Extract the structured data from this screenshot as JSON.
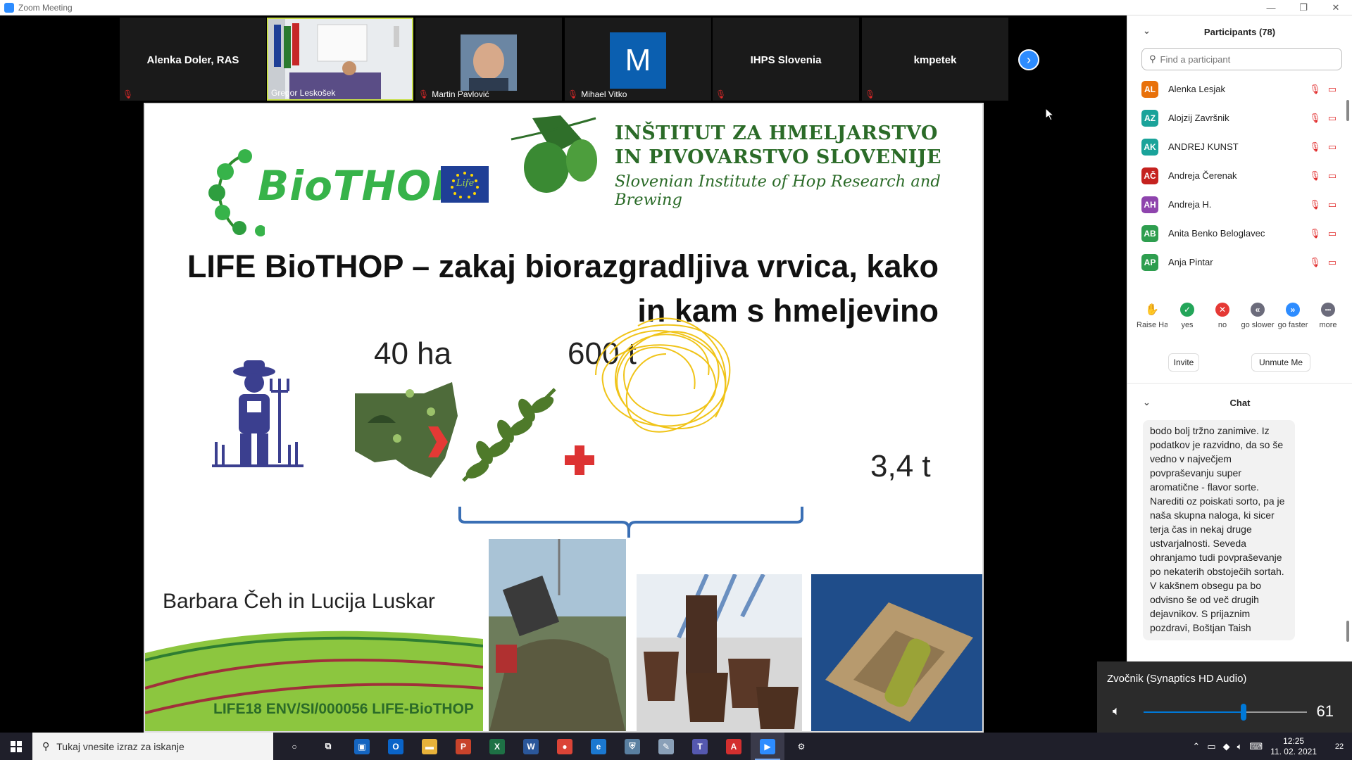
{
  "window": {
    "title": "Zoom Meeting",
    "controls": [
      "—",
      "❐",
      "✕"
    ]
  },
  "video_strip": {
    "tiles": [
      {
        "name": "Alenka Doler, RAS",
        "label": ""
      },
      {
        "name": "",
        "label": "Gregor Leskošek"
      },
      {
        "name": "",
        "label": "Martin Pavlović"
      },
      {
        "name": "",
        "label": "Mihael Vitko",
        "initial": "M"
      },
      {
        "name": "IHPS Slovenia",
        "label": ""
      },
      {
        "name": "kmpetek",
        "label": ""
      }
    ],
    "next_icon": "chevron-right-icon"
  },
  "slide": {
    "logo_text": "BioTHOP",
    "eu_label": "Life",
    "institute_line1": "INŠTITUT ZA HMELJARSTVO",
    "institute_line2": "IN PIVOVARSTVO SLOVENIJE",
    "institute_line3": "Slovenian Institute of Hop Research and Brewing",
    "title_line1": "LIFE BioTHOP – zakaj biorazgradljiva vrvica, kako",
    "title_line2": "in kam s hmeljevino",
    "stat_area": "40 ha",
    "stat_biomass": "600 t",
    "stat_twine": "3,4 t",
    "authors": "Barbara Čeh in Lucija Luskar",
    "project_code": "LIFE18 ENV/SI/000056 LIFE-BioTHOP"
  },
  "participants_panel": {
    "title": "Participants (78)",
    "search_placeholder": "Find a participant",
    "participants": [
      {
        "initials": "AL",
        "name": "Alenka Lesjak",
        "color": "#e8710a"
      },
      {
        "initials": "AZ",
        "name": "Alojzij Završnik",
        "color": "#1aa39a"
      },
      {
        "initials": "AK",
        "name": "ANDREJ KUNST",
        "color": "#1aa39a"
      },
      {
        "initials": "AČ",
        "name": "Andreja Čerenak",
        "color": "#c5221f"
      },
      {
        "initials": "AH",
        "name": "Andreja H.",
        "color": "#8e44ad"
      },
      {
        "initials": "AB",
        "name": "Anita Benko Beloglavec",
        "color": "#2e9e4f"
      },
      {
        "initials": "AP",
        "name": "Anja Pintar",
        "color": "#2e9e4f"
      }
    ],
    "reactions": [
      {
        "label": "Raise Hand",
        "icon": "raise-hand-icon",
        "symbol": "✋",
        "color": "#2d8cff"
      },
      {
        "label": "yes",
        "icon": "check-icon",
        "symbol": "✓",
        "color": "#23a559"
      },
      {
        "label": "no",
        "icon": "x-icon",
        "symbol": "✕",
        "color": "#e53935"
      },
      {
        "label": "go slower",
        "icon": "rewind-icon",
        "symbol": "«",
        "color": "#6b6b7b"
      },
      {
        "label": "go faster",
        "icon": "fast-forward-icon",
        "symbol": "»",
        "color": "#2d8cff"
      },
      {
        "label": "more",
        "icon": "more-icon",
        "symbol": "•••",
        "color": "#6b6b7b"
      }
    ],
    "invite_label": "Invite",
    "unmute_label": "Unmute Me"
  },
  "chat": {
    "title": "Chat",
    "message": "bodo bolj tržno zanimive. Iz podatkov je razvidno, da so še vedno v največjem povpraševanju super aromatične - flavor sorte. Narediti oz poiskati sorto, pa je naša skupna naloga, ki sicer terja čas in nekaj druge ustvarjalnosti. Seveda ohranjamo tudi povpraševanje po nekaterih obstoječih sortah. V kakšnem obsegu pa bo odvisno še od več drugih dejavnikov.   S prijaznim pozdravi, Boštjan Taish"
  },
  "volume": {
    "device": "Zvočnik (Synaptics HD Audio)",
    "level": 61
  },
  "taskbar": {
    "search_placeholder": "Tukaj vnesite izraz za iskanje",
    "apps": [
      {
        "icon": "cortana-icon",
        "symbol": "○",
        "color": "transparent"
      },
      {
        "icon": "task-view-icon",
        "symbol": "⧉",
        "color": "transparent"
      },
      {
        "icon": "window-app-icon",
        "symbol": "▣",
        "color": "#1565c0"
      },
      {
        "icon": "outlook-icon",
        "symbol": "O",
        "color": "#0a64c8"
      },
      {
        "icon": "file-explorer-icon",
        "symbol": "▬",
        "color": "#e8b23a"
      },
      {
        "icon": "powerpoint-icon",
        "symbol": "P",
        "color": "#c8432b"
      },
      {
        "icon": "excel-icon",
        "symbol": "X",
        "color": "#1e7145"
      },
      {
        "icon": "word-icon",
        "symbol": "W",
        "color": "#2b579a"
      },
      {
        "icon": "chrome-icon",
        "symbol": "●",
        "color": "#db4437"
      },
      {
        "icon": "edge-icon",
        "symbol": "e",
        "color": "#1b78d0"
      },
      {
        "icon": "shield-app-icon",
        "symbol": "⛨",
        "color": "#5a7fa0"
      },
      {
        "icon": "paint-icon",
        "symbol": "✎",
        "color": "#8aa0b8"
      },
      {
        "icon": "teams-icon",
        "symbol": "T",
        "color": "#5558af"
      },
      {
        "icon": "acrobat-icon",
        "symbol": "A",
        "color": "#d32f2f"
      },
      {
        "icon": "zoom-icon",
        "symbol": "▶",
        "color": "#2d8cff"
      },
      {
        "icon": "settings-icon",
        "symbol": "⚙",
        "color": "transparent"
      }
    ],
    "time": "12:25",
    "date": "11. 02. 2021",
    "notifications": "22"
  }
}
